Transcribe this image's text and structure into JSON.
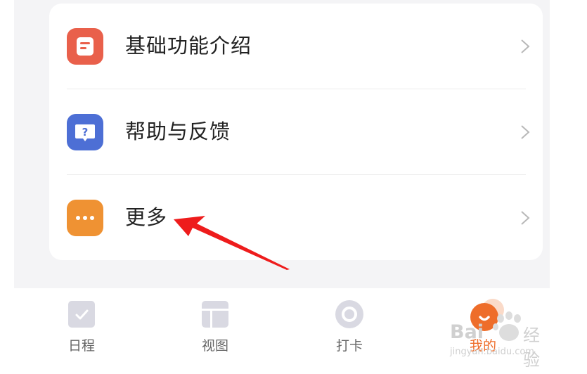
{
  "menu": {
    "items": [
      {
        "label": "基础功能介绍",
        "icon": "document-icon",
        "color": "#e9604b"
      },
      {
        "label": "帮助与反馈",
        "icon": "help-chat-icon",
        "color": "#4d6fd5"
      },
      {
        "label": "更多",
        "icon": "more-dots-icon",
        "color": "#ef9233"
      }
    ]
  },
  "annotation": {
    "type": "red-arrow",
    "points_to": "更多",
    "color": "#ee1c1c"
  },
  "tabbar": {
    "tabs": [
      {
        "label": "日程",
        "icon": "checkbox-icon",
        "active": false
      },
      {
        "label": "视图",
        "icon": "layout-icon",
        "active": false
      },
      {
        "label": "打卡",
        "icon": "ring-icon",
        "active": false
      },
      {
        "label": "我的",
        "icon": "smile-avatar-icon",
        "active": true
      }
    ],
    "active_color": "#ee6d2a",
    "inactive_color": "#d9d9e2"
  },
  "watermark": {
    "brand": "Bai",
    "brand_cn": "经验",
    "url": "jingyan.baidu.com"
  }
}
